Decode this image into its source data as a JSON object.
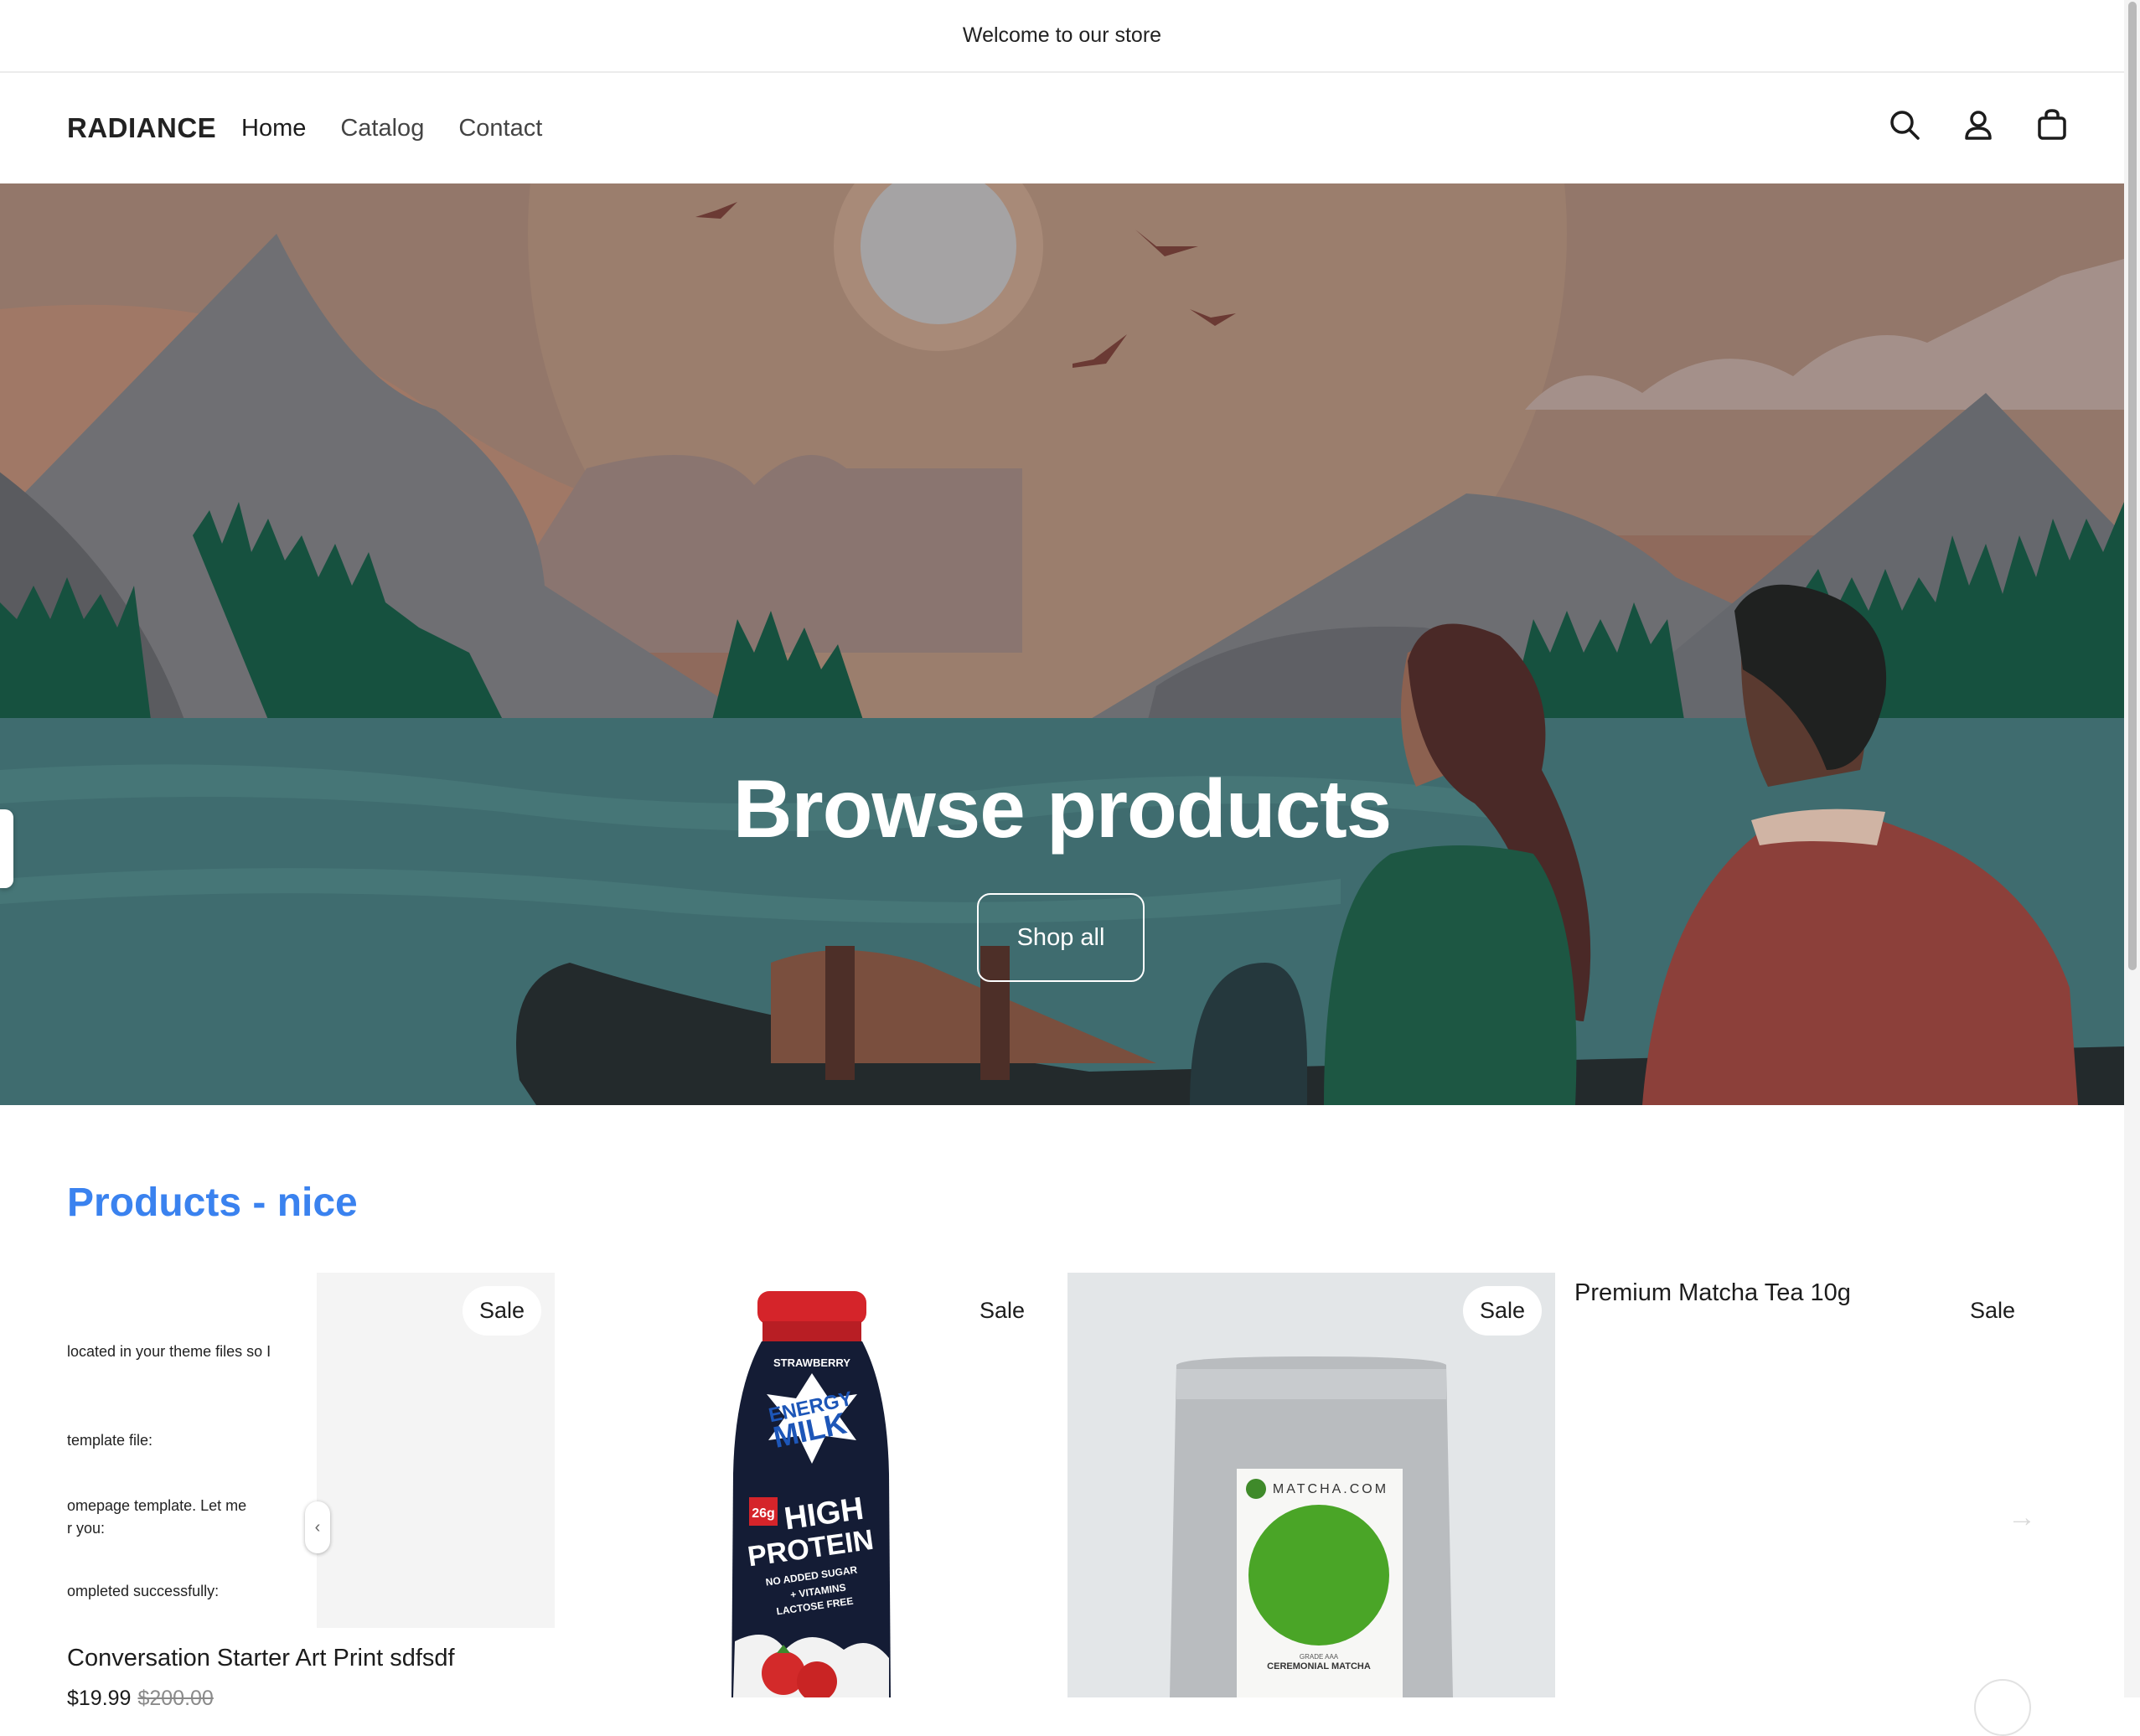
{
  "announcement": "Welcome to our store",
  "header": {
    "logo": "RADIANCE",
    "nav": [
      "Home",
      "Catalog",
      "Contact"
    ],
    "icons": [
      "search-icon",
      "account-icon",
      "cart-icon"
    ]
  },
  "hero": {
    "title": "Browse products",
    "button": "Shop all"
  },
  "section": {
    "heading": "Products - nice",
    "heading_color": "#3a82ef"
  },
  "doc_snippet": [
    "located in your theme files so I",
    "template file:",
    "omepage template. Let me",
    "r you:",
    "ompleted successfully:"
  ],
  "products": [
    {
      "title": "Conversation Starter Art Print sdfsdf",
      "price": "$19.99",
      "compare_price": "$200.00",
      "badge": "Sale"
    },
    {
      "badge": "Sale",
      "image_text": [
        "STRAWBERRY",
        "ENERGY",
        "MILK",
        "26g",
        "HIGH",
        "PROTEIN",
        "NO ADDED SUGAR",
        "+ VITAMINS",
        "LACTOSE FREE"
      ]
    },
    {
      "badge": "Sale",
      "image_text": [
        "MATCHA.COM",
        "GRADE AAA",
        "CEREMONIAL MATCHA"
      ]
    },
    {
      "title": "Premium Matcha Tea 10g",
      "badge": "Sale"
    }
  ]
}
